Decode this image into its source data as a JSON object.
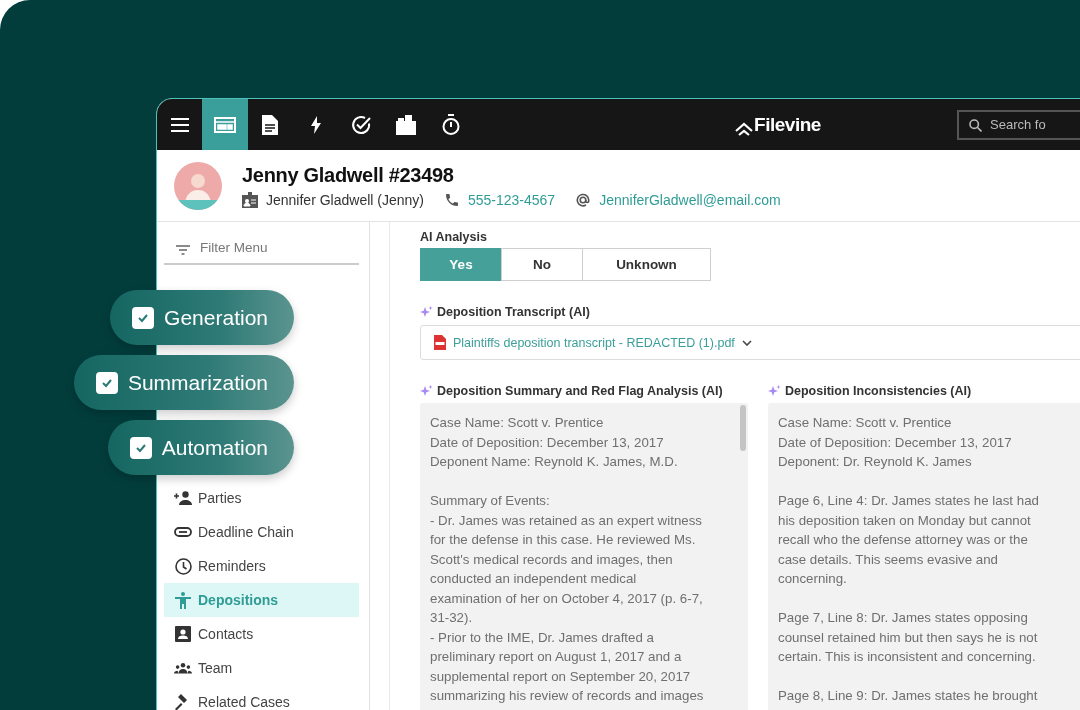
{
  "toolbar": {
    "tools": [
      {
        "selected": false
      },
      {
        "selected": true
      },
      {
        "selected": false
      },
      {
        "selected": false
      },
      {
        "selected": false
      },
      {
        "selected": false
      },
      {
        "selected": false
      }
    ],
    "logo": "Filevine",
    "search": {
      "placeholder": "Search fo"
    }
  },
  "contact": {
    "name": "Jenny Gladwell #23498",
    "full_name": "Jennifer Gladwell (Jenny)",
    "phone": "555-123-4567",
    "email": "JenniferGladwell@email.com"
  },
  "sidebar": {
    "filter": {
      "placeholder": "Filter Menu"
    },
    "items": [
      {
        "label": "Parties",
        "selected": false
      },
      {
        "label": "Deadline Chain",
        "selected": false
      },
      {
        "label": "Reminders",
        "selected": false
      },
      {
        "label": "Depositions",
        "selected": true
      },
      {
        "label": "Contacts",
        "selected": false
      },
      {
        "label": "Team",
        "selected": false
      },
      {
        "label": "Related Cases",
        "selected": false
      }
    ]
  },
  "badges": [
    {
      "label": "Generation",
      "checked": true
    },
    {
      "label": "Summarization",
      "checked": true
    },
    {
      "label": "Automation",
      "checked": true
    }
  ],
  "ai_analysis": {
    "label": "AI Analysis",
    "options": [
      {
        "label": "Yes",
        "selected": true
      },
      {
        "label": "No",
        "selected": false
      },
      {
        "label": "Unknown",
        "selected": false
      }
    ]
  },
  "transcript": {
    "label": "Deposition Transcript (AI)",
    "file": "Plaintiffs deposition transcript - REDACTED (1).pdf"
  },
  "panels": [
    {
      "title": "Deposition Summary and Red Flag Analysis (AI)",
      "paragraphs": [
        [
          "Case Name: Scott v. Prentice",
          "Date of Deposition: December 13, 2017",
          "Deponent Name: Reynold K. James, M.D."
        ],
        [
          "Summary of Events:",
          "- Dr. James was retained as an expert witness",
          "for the defense in this case. He reviewed Ms.",
          "Scott's medical records and images, then",
          "conducted an independent medical",
          "examination of her on October 4, 2017 (p. 6-7,",
          "31-32).",
          "- Prior to the IME, Dr. James drafted a",
          "preliminary report on August 1, 2017 and a",
          "supplemental report on September 20, 2017",
          "summarizing his review of records and images"
        ]
      ]
    },
    {
      "title": "Deposition Inconsistencies (AI)",
      "paragraphs": [
        [
          "Case Name: Scott v. Prentice",
          "Date of Deposition: December 13, 2017",
          "Deponent: Dr. Reynold K. James"
        ],
        [
          "Page 6, Line 4: Dr. James states he last had",
          "his deposition taken on Monday but cannot",
          "recall who the defense attorney was or the",
          "case details. This seems evasive and",
          "concerning."
        ],
        [
          "Page 7, Line 8: Dr. James states opposing",
          "counsel retained him but then says he is not",
          "certain. This is inconsistent and concerning."
        ],
        [
          "Page 8, Line 9: Dr. James states he brought"
        ]
      ]
    }
  ]
}
